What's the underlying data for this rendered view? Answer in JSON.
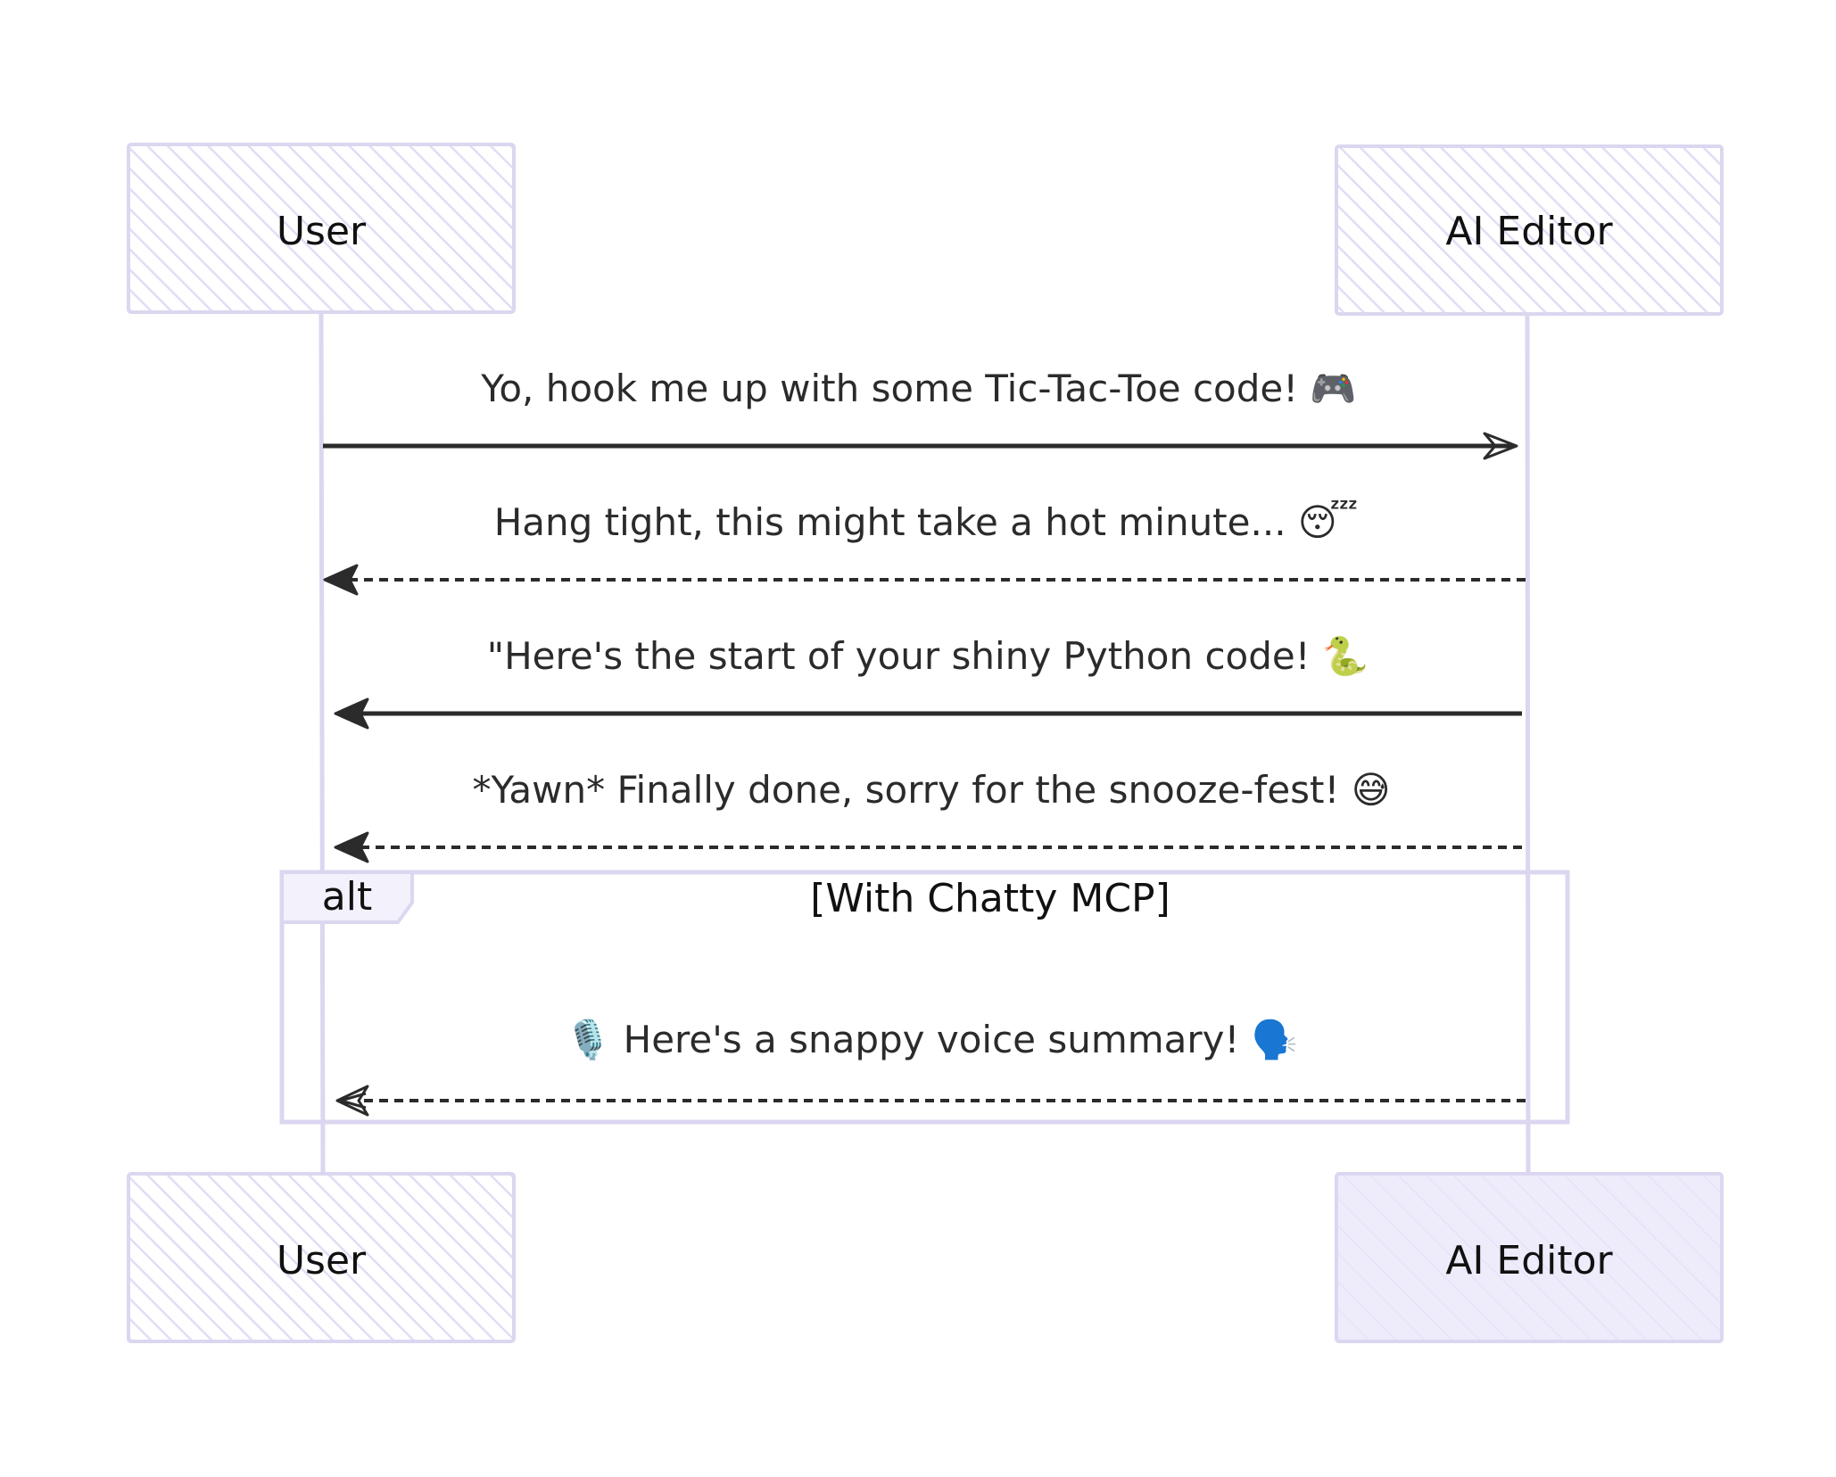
{
  "participants": {
    "left": {
      "name": "User"
    },
    "right": {
      "name": "AI Editor"
    }
  },
  "messages": [
    {
      "text": "Yo, hook me up with some Tic-Tac-Toe code! 🎮",
      "from": "User",
      "to": "AI Editor",
      "style": "solid",
      "arrowhead": "open"
    },
    {
      "text": "Hang tight, this might take a hot minute... 😴",
      "from": "AI Editor",
      "to": "User",
      "style": "dashed",
      "arrowhead": "filled"
    },
    {
      "text": "\"Here's the start of your shiny Python code! 🐍",
      "from": "AI Editor",
      "to": "User",
      "style": "solid",
      "arrowhead": "filled"
    },
    {
      "text": "*Yawn* Finally done, sorry for the snooze-fest! 😅",
      "from": "AI Editor",
      "to": "User",
      "style": "dashed",
      "arrowhead": "filled"
    }
  ],
  "alt_block": {
    "keyword": "alt",
    "condition": "[With Chatty MCP]",
    "message": {
      "text": "🎙️ Here's a snappy voice summary! 🗣️",
      "from": "AI Editor",
      "to": "User",
      "style": "dashed",
      "arrowhead": "open"
    }
  },
  "colors": {
    "box_stroke": "#dcd6f0",
    "box_fill": "#eeebfb",
    "hatch": "#e2ddf5",
    "arrow": "#2b2b2b",
    "text": "#111111"
  }
}
